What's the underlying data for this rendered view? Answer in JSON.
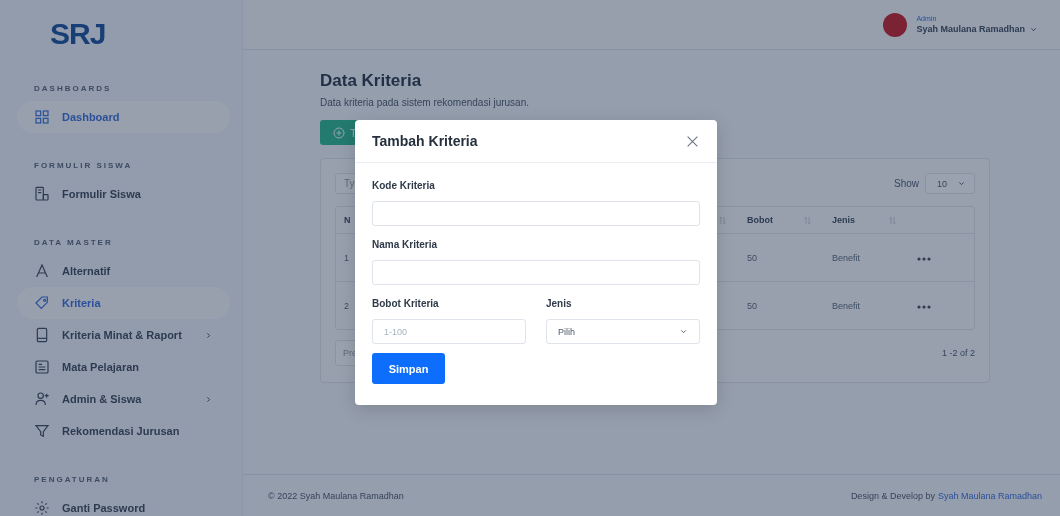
{
  "sidebar": {
    "logo": "SRJ",
    "sections": [
      {
        "title": "DASHBOARDS",
        "items": [
          {
            "label": "Dashboard",
            "selected": true,
            "expandable": false
          }
        ]
      },
      {
        "title": "FORMULIR SISWA",
        "items": [
          {
            "label": "Formulir Siswa",
            "selected": false,
            "expandable": false
          }
        ]
      },
      {
        "title": "DATA MASTER",
        "items": [
          {
            "label": "Alternatif",
            "selected": false,
            "expandable": false
          },
          {
            "label": "Kriteria",
            "selected": true,
            "expandable": false
          },
          {
            "label": "Kriteria Minat & Raport",
            "selected": false,
            "expandable": true
          },
          {
            "label": "Mata Pelajaran",
            "selected": false,
            "expandable": false
          },
          {
            "label": "Admin & Siswa",
            "selected": false,
            "expandable": true
          },
          {
            "label": "Rekomendasi Jurusan",
            "selected": false,
            "expandable": false
          }
        ]
      },
      {
        "title": "PENGATURAN",
        "items": [
          {
            "label": "Ganti Password",
            "selected": false,
            "expandable": false
          }
        ]
      }
    ]
  },
  "header": {
    "role": "Admin",
    "user": "Syah Maulana Ramadhan"
  },
  "page": {
    "title": "Data Kriteria",
    "subtitle": "Data kriteria pada sistem rekomendasi jurusan.",
    "add_button": "T"
  },
  "table": {
    "search_placeholder": "Ty",
    "show_label": "Show",
    "show_value": "10",
    "columns": [
      "N",
      "",
      "Bobot",
      "Jenis"
    ],
    "rows": [
      {
        "number": "1",
        "bobot": "50",
        "jenis": "Benefit"
      },
      {
        "number": "2",
        "bobot": "50",
        "jenis": "Benefit"
      }
    ],
    "prev": "Pre",
    "range": "1 -2 of 2"
  },
  "footer": {
    "copyright": "© 2022 Syah Maulana Ramadhan",
    "credit": "Design & Develop by",
    "credit_link": "Syah Maulana Ramadhan"
  },
  "modal": {
    "title": "Tambah Kriteria",
    "fields": [
      {
        "kind": "text",
        "label": "Kode Kriteria"
      },
      {
        "kind": "text",
        "label": "Nama Kriteria"
      },
      {
        "kind": "text",
        "label": "Bobot Kriteria",
        "placeholder": "1-100"
      },
      {
        "kind": "select",
        "label": "Jenis",
        "value": "Pilih"
      }
    ],
    "submit": "Simpan"
  }
}
